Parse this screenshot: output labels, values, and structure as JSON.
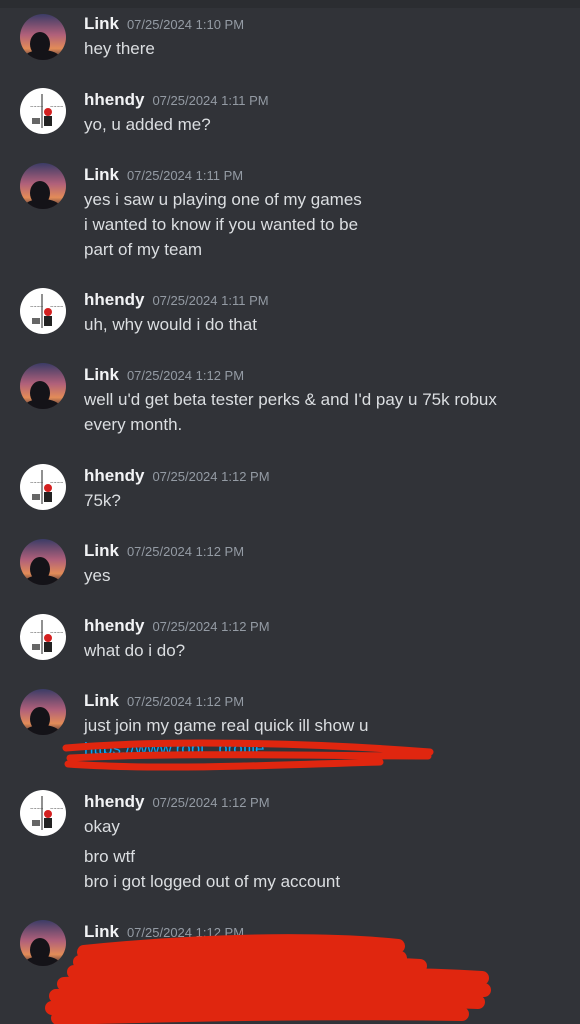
{
  "colors": {
    "background": "#313338",
    "username": "#f2f3f5",
    "timestamp": "#949ba4",
    "text": "#dbdee1",
    "link": "#00a8fc",
    "redaction": "#e0260f"
  },
  "users": {
    "link": {
      "name": "Link",
      "avatar": "sunset-silhouette-avatar"
    },
    "hhendy": {
      "name": "hhendy",
      "avatar": "manga-drawing-avatar"
    }
  },
  "messages": [
    {
      "author": "Link",
      "time": "07/25/2024 1:10 PM",
      "lines": [
        "hey there"
      ]
    },
    {
      "author": "hhendy",
      "time": "07/25/2024 1:11 PM",
      "lines": [
        "yo, u added me?"
      ]
    },
    {
      "author": "Link",
      "time": "07/25/2024 1:11 PM",
      "lines": [
        "yes i saw u playing one of my games",
        "i wanted to know if you wanted to be",
        "part of my team"
      ]
    },
    {
      "author": "hhendy",
      "time": "07/25/2024 1:11 PM",
      "lines": [
        "uh, why would i do that"
      ]
    },
    {
      "author": "Link",
      "time": "07/25/2024 1:12 PM",
      "lines": [
        "well u'd get beta tester perks & and I'd pay u 75k robux",
        "every month."
      ]
    },
    {
      "author": "hhendy",
      "time": "07/25/2024 1:12 PM",
      "lines": [
        "75k?"
      ]
    },
    {
      "author": "Link",
      "time": "07/25/2024 1:12 PM",
      "lines": [
        "yes"
      ]
    },
    {
      "author": "hhendy",
      "time": "07/25/2024 1:12 PM",
      "lines": [
        "what do i do?"
      ]
    },
    {
      "author": "Link",
      "time": "07/25/2024 1:12 PM",
      "lines": [
        "just join my game real quick ill show u"
      ],
      "link_fragment": "https://www.robl...profile"
    },
    {
      "author": "hhendy",
      "time": "07/25/2024 1:12 PM",
      "lines": [
        "okay",
        "bro wtf",
        "bro i got logged out of my account"
      ]
    },
    {
      "author": "Link",
      "time": "07/25/2024 1:12 PM",
      "lines": []
    }
  ]
}
